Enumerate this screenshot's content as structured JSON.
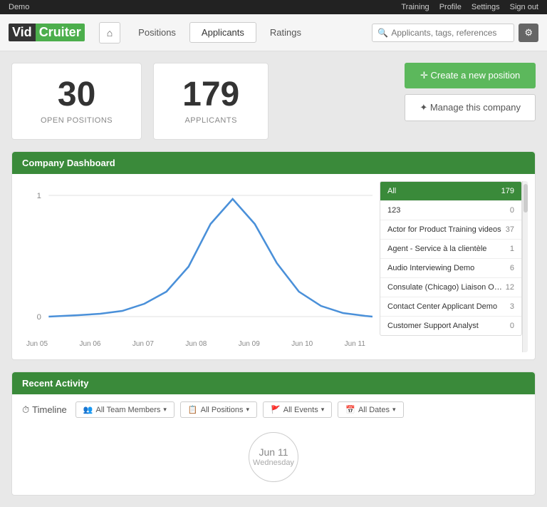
{
  "topbar": {
    "demo_label": "Demo",
    "links": [
      "Training",
      "Profile",
      "Settings",
      "Sign out"
    ]
  },
  "logo": {
    "vid": "Vid",
    "cruiter": "Cruiter"
  },
  "nav": {
    "home_icon": "⌂",
    "tabs": [
      "Positions",
      "Applicants",
      "Ratings"
    ],
    "active_tab": "Applicants",
    "search_placeholder": "Applicants, tags, references"
  },
  "stats": {
    "open_positions": {
      "number": "30",
      "label": "OPEN POSITIONS"
    },
    "applicants": {
      "number": "179",
      "label": "APPLICANTS"
    }
  },
  "buttons": {
    "create": "✛ Create a new position",
    "manage": "✦ Manage this company"
  },
  "dashboard": {
    "title": "Company Dashboard",
    "x_labels": [
      "Jun 05",
      "Jun 06",
      "Jun 07",
      "Jun 08",
      "Jun 09",
      "Jun 10",
      "Jun 11"
    ],
    "y_labels": [
      "1",
      "0"
    ],
    "positions": [
      {
        "name": "All",
        "count": "179",
        "active": true
      },
      {
        "name": "123",
        "count": "0",
        "active": false
      },
      {
        "name": "Actor for Product Training videos",
        "count": "37",
        "active": false
      },
      {
        "name": "Agent - Service à la clientèle",
        "count": "1",
        "active": false
      },
      {
        "name": "Audio Interviewing Demo",
        "count": "6",
        "active": false
      },
      {
        "name": "Consulate (Chicago) Liaison Officer",
        "count": "12",
        "active": false
      },
      {
        "name": "Contact Center Applicant Demo",
        "count": "3",
        "active": false
      },
      {
        "name": "Customer Support Analyst",
        "count": "0",
        "active": false
      }
    ]
  },
  "recent_activity": {
    "title": "Recent Activity",
    "timeline_label": "Timeline",
    "filters": [
      {
        "icon": "👥",
        "label": "All Team Members",
        "key": "team"
      },
      {
        "icon": "📋",
        "label": "All Positions",
        "key": "positions"
      },
      {
        "icon": "🚩",
        "label": "All Events",
        "key": "events"
      },
      {
        "icon": "📅",
        "label": "All Dates",
        "key": "dates"
      }
    ],
    "date": {
      "month": "Jun 11",
      "day": "Wednesday"
    }
  }
}
